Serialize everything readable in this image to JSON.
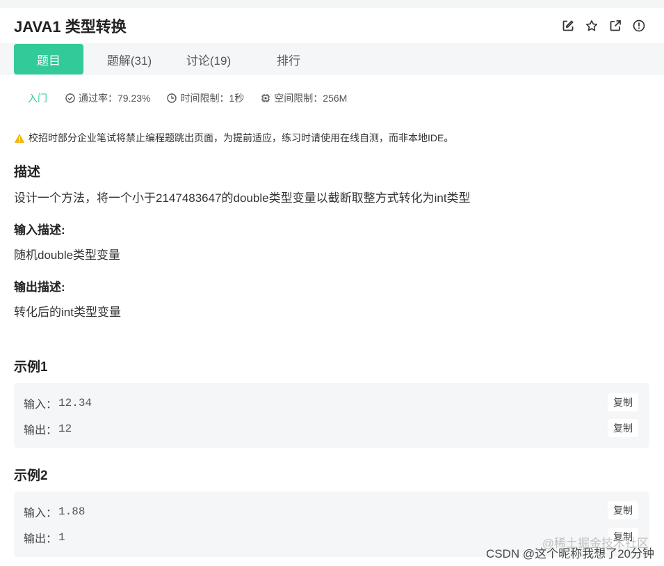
{
  "problem": {
    "title": "JAVA1  类型转换"
  },
  "toolbar_icons": [
    "edit-icon",
    "star-icon",
    "share-icon",
    "info-icon"
  ],
  "tabs": [
    {
      "label": "题目",
      "active": true
    },
    {
      "label": "题解(31)",
      "active": false
    },
    {
      "label": "讨论(19)",
      "active": false
    },
    {
      "label": "排行",
      "active": false
    }
  ],
  "meta": {
    "difficulty": "入门",
    "pass_rate": "通过率：79.23%",
    "time_limit": "时间限制：1秒",
    "space_limit": "空间限制：256M"
  },
  "warning": "校招时部分企业笔试将禁止编程题跳出页面，为提前适应，练习时请使用在线自测，而非本地IDE。",
  "description": {
    "heading": "描述",
    "text": "设计一个方法，将一个小于2147483647的double类型变量以截断取整方式转化为int类型"
  },
  "input_desc": {
    "heading": "输入描述:",
    "text": "随机double类型变量"
  },
  "output_desc": {
    "heading": "输出描述:",
    "text": "转化后的int类型变量"
  },
  "examples": [
    {
      "heading": "示例1",
      "input_label": "输入：",
      "input": "12.34",
      "output_label": "输出：",
      "output": "12",
      "copy_label": "复制"
    },
    {
      "heading": "示例2",
      "input_label": "输入：",
      "input": "1.88",
      "output_label": "输出：",
      "output": "1",
      "copy_label": "复制"
    }
  ],
  "watermark": {
    "line1": "@稀土掘金技术社区",
    "line2": "CSDN @这个昵称我想了20分钟"
  },
  "colors": {
    "accent": "#32ca99",
    "warning": "#f5b400"
  }
}
